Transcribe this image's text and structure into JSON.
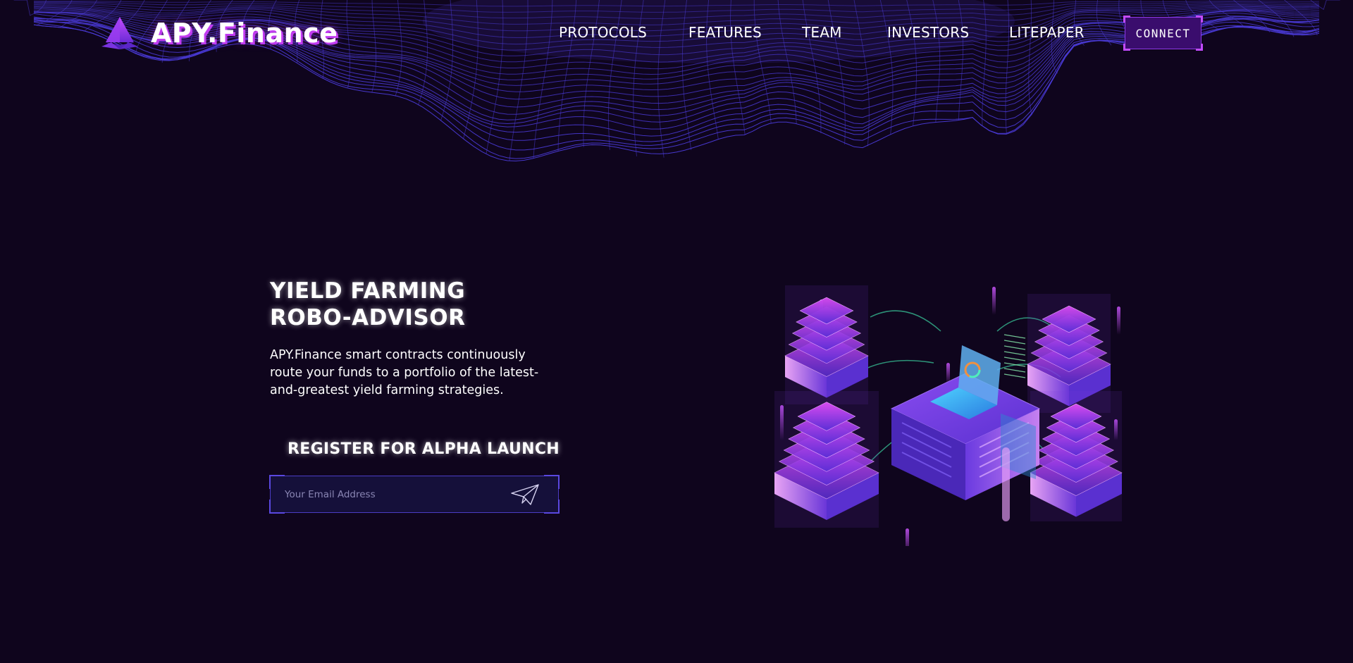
{
  "brand": {
    "name": "APY.Finance",
    "logo_icon": "pyramid-logo-icon",
    "accent": "#c13cf0"
  },
  "nav": {
    "items": [
      {
        "label": "PROTOCOLS"
      },
      {
        "label": "FEATURES"
      },
      {
        "label": "TEAM"
      },
      {
        "label": "INVESTORS"
      },
      {
        "label": "LITEPAPER"
      }
    ],
    "connect_label": "CONNECT"
  },
  "hero": {
    "title": "YIELD FARMING ROBO-ADVISOR",
    "description": "APY.Finance smart contracts continuously route your funds to a portfolio of the latest-and-greatest yield farming strategies."
  },
  "register": {
    "title": "REGISTER FOR ALPHA LAUNCH",
    "email_placeholder": "Your Email Address",
    "email_value": "",
    "submit_icon": "paper-plane-icon"
  },
  "colors": {
    "background": "#0f051d",
    "mesh": "#4a3ad6",
    "button_bg": "#3a0d6d",
    "input_border": "#4b3cc4"
  }
}
